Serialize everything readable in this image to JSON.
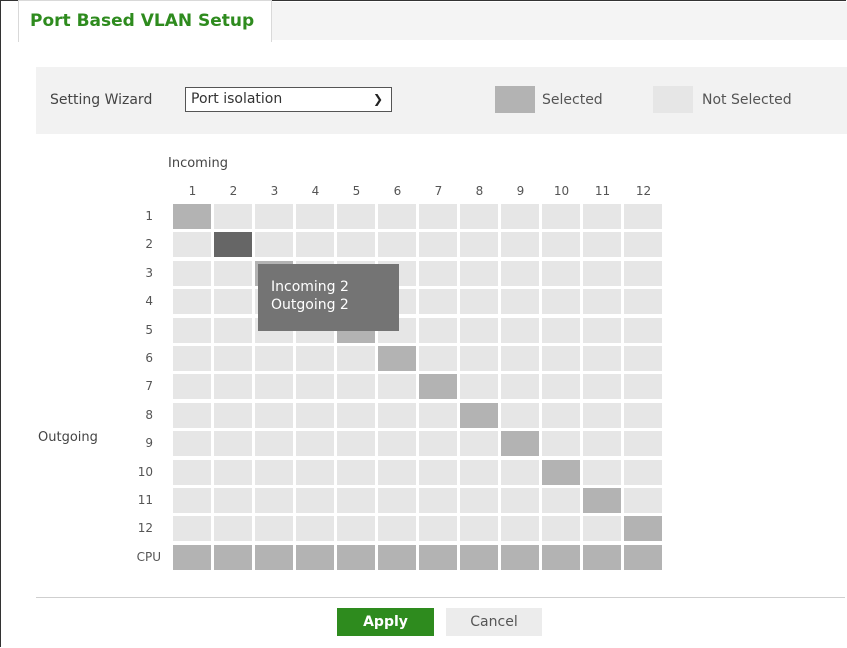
{
  "tab": {
    "title": "Port Based VLAN Setup"
  },
  "wizard": {
    "label": "Setting Wizard",
    "selected": "Port isolation"
  },
  "legend": {
    "selected_label": "Selected",
    "selected_color": "#b3b3b3",
    "not_selected_label": "Not Selected",
    "not_selected_color": "#e6e6e6"
  },
  "matrix": {
    "incoming_label": "Incoming",
    "outgoing_label": "Outgoing",
    "columns": [
      "1",
      "2",
      "3",
      "4",
      "5",
      "6",
      "7",
      "8",
      "9",
      "10",
      "11",
      "12"
    ],
    "rows": [
      "1",
      "2",
      "3",
      "4",
      "5",
      "6",
      "7",
      "8",
      "9",
      "10",
      "11",
      "12",
      "CPU"
    ],
    "selected_pairs": "diagonal + CPU row all selected",
    "hovered": {
      "incoming": 2,
      "outgoing": 2,
      "color": "#666666"
    },
    "cell_color": "#e6e6e6",
    "selected_color": "#b3b3b3"
  },
  "tooltip": {
    "line1": "Incoming 2",
    "line2": "Outgoing 2"
  },
  "buttons": {
    "apply": "Apply",
    "cancel": "Cancel"
  }
}
